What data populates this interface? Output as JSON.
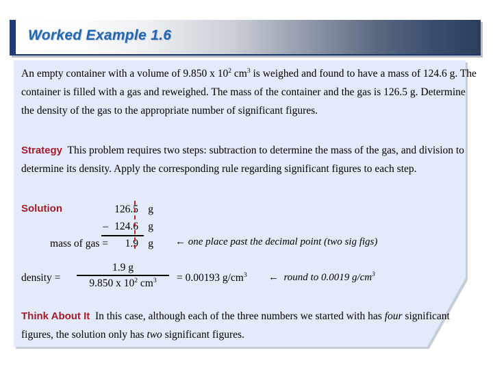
{
  "slide": {
    "title": "Worked Example 1.6",
    "accent_color": "#1f3c7a",
    "title_text_color": "#2566ac",
    "panel_color": "#e3eafa",
    "heading_color": "#a21c2b"
  },
  "problem": {
    "text_1": "An empty container with a volume of 9.850 x 10",
    "sup_1": "2",
    "text_2": " cm",
    "sup_2": "3",
    "text_3": " is weighed and found to have a mass of 124.6 g.  The container is filled with a gas and reweighed.  The mass of the container and the gas is 126.5 g. Determine the density of the gas to the appropriate number of significant figures."
  },
  "strategy": {
    "label": "Strategy",
    "text": "This problem requires two steps: subtraction to determine the mass of the gas, and division to determine its density. Apply the corresponding rule regarding significant figures to each step."
  },
  "solution": {
    "label": "Solution",
    "rows": [
      {
        "lead": "",
        "number": "126.5",
        "unit": "g"
      },
      {
        "lead": "–",
        "number": "124.6",
        "unit": "g"
      },
      {
        "lead": "mass of gas =",
        "number": "1.9",
        "unit": "g"
      }
    ],
    "note": "←  one place past the decimal point (two sig figs)"
  },
  "density": {
    "label": "density =",
    "numerator": "1.9 g",
    "denominator_1": "9.850 x 10",
    "denominator_sup_1": "2",
    "denominator_2": " cm",
    "denominator_sup_2": "3",
    "result_prefix": "= 0.00193 g/cm",
    "result_sup": "3",
    "note_arrow": "←",
    "note_1": "round to 0.0019 g/cm",
    "note_sup": "3"
  },
  "think_about_it": {
    "label": "Think About It",
    "text_1": "In this case, although each of the three numbers we started with has ",
    "italic_1": "four",
    "text_2": " significant figures, the solution only has ",
    "italic_2": "two",
    "text_3": " significant figures."
  }
}
